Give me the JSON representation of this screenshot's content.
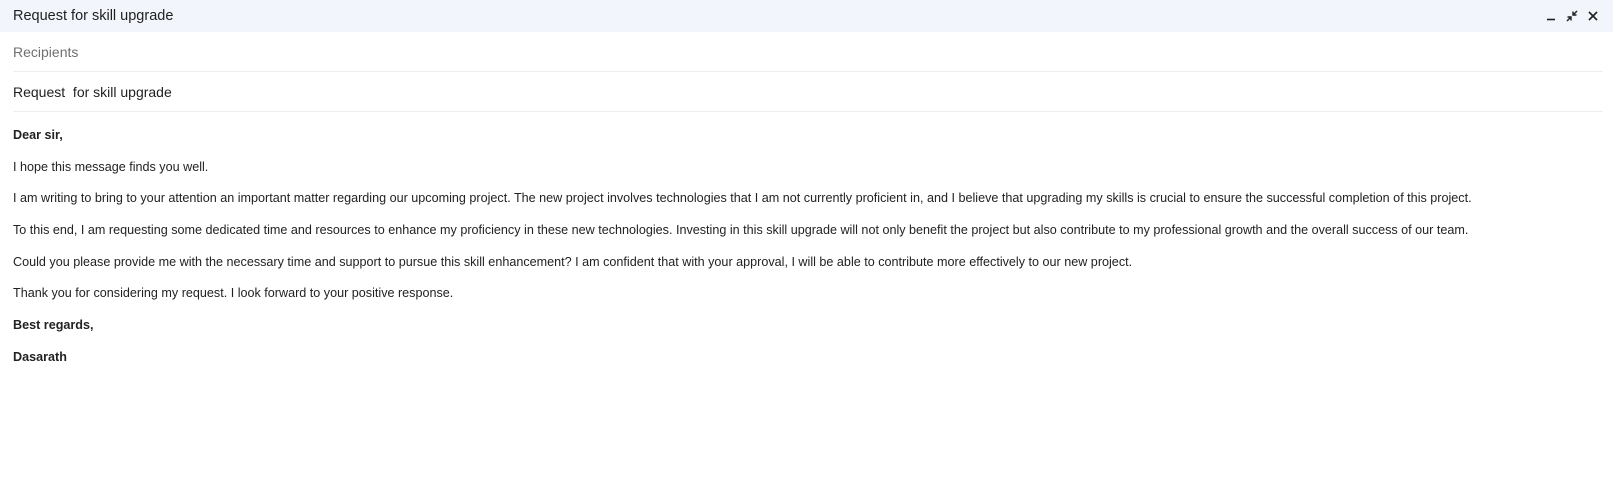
{
  "window": {
    "title": "Request for skill upgrade",
    "controls": [
      "minimize-icon",
      "exit-fullscreen-icon",
      "close-icon"
    ]
  },
  "fields": {
    "recipients_placeholder": "Recipients",
    "subject": "Request  for skill upgrade"
  },
  "body": {
    "greeting": "Dear sir,",
    "paragraphs": [
      "I hope this message finds you well.",
      "I am writing to bring to your attention an important matter regarding our upcoming project. The new project involves technologies that I am not currently proficient in, and I believe that upgrading my skills is crucial to ensure the successful completion of this project.",
      "To this end, I am requesting some dedicated time and resources to enhance my proficiency in these new technologies. Investing in this skill upgrade will not only benefit the project but also contribute to my professional growth and the overall success of our team.",
      "Could you please provide me with the necessary time and support to pursue this skill enhancement? I am confident that with your approval, I will be able to contribute more effectively to our new project.",
      "Thank you for considering my request. I look forward to your positive response."
    ],
    "closing": "Best regards,",
    "signature": "Dasarath"
  },
  "colors": {
    "title_bar_bg": "#f2f6fc",
    "divider": "#eceff1",
    "placeholder_text": "#6f6f6f"
  }
}
